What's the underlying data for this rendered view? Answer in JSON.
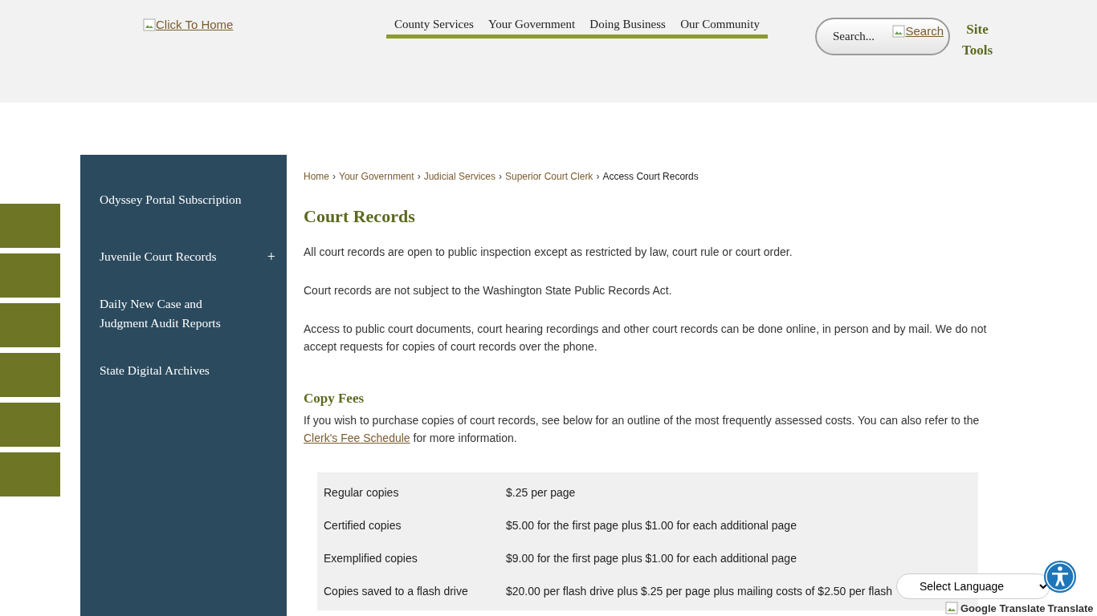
{
  "header": {
    "logo_alt": "Click To Home",
    "nav": [
      {
        "label": "County Services"
      },
      {
        "label": "Your Government"
      },
      {
        "label": "Doing Business"
      },
      {
        "label": "Our Community"
      }
    ],
    "search": {
      "placeholder": "Search...",
      "button_alt": "Search"
    },
    "site_tools": "Site Tools"
  },
  "sidebar": {
    "items": [
      {
        "label": "Odyssey Portal Subscription"
      },
      {
        "label": "Juvenile Court Records",
        "toggle": "+"
      },
      {
        "label": "Daily New Case and Judgment Audit Reports"
      },
      {
        "label": "State Digital Archives"
      }
    ]
  },
  "breadcrumb": [
    {
      "label": "Home",
      "link": true
    },
    {
      "label": "Your Government",
      "link": true
    },
    {
      "label": "Judicial Services",
      "link": true
    },
    {
      "label": "Superior Court Clerk",
      "link": true
    },
    {
      "label": "Access Court Records",
      "link": false
    }
  ],
  "breadcrumb_separator": "›",
  "title": "Court Records",
  "paragraphs": [
    "All court records are open to public inspection except as restricted by law, court rule or court order.",
    "Court records are not subject to the Washington State Public Records Act.",
    "Access to public court documents, court hearing recordings and other court records can be done online, in person and by mail. We do not accept requests for copies of court records over the phone."
  ],
  "copy_fees": {
    "heading": "Copy Fees",
    "intro_before": "If you wish to purchase copies of court records, see below for an outline of the most frequently assessed costs. You can also refer to the",
    "link": "Clerk's Fee Schedule",
    "intro_after": "for more information.",
    "rows": [
      {
        "item": "Regular copies",
        "cost": "$.25 per page"
      },
      {
        "item": "Certified copies",
        "cost": "$5.00 for the first page plus $1.00 for each additional page"
      },
      {
        "item": "Exemplified copies",
        "cost": "$9.00 for the first page plus $1.00 for each additional page"
      },
      {
        "item": "Copies saved to a flash drive",
        "cost": "$20.00 per flash drive plus $.25 per page plus mailing costs of $2.50 per flash"
      }
    ]
  },
  "language_select": "Select Language",
  "translate": {
    "alt": "Google Translate",
    "label": "Translate"
  }
}
